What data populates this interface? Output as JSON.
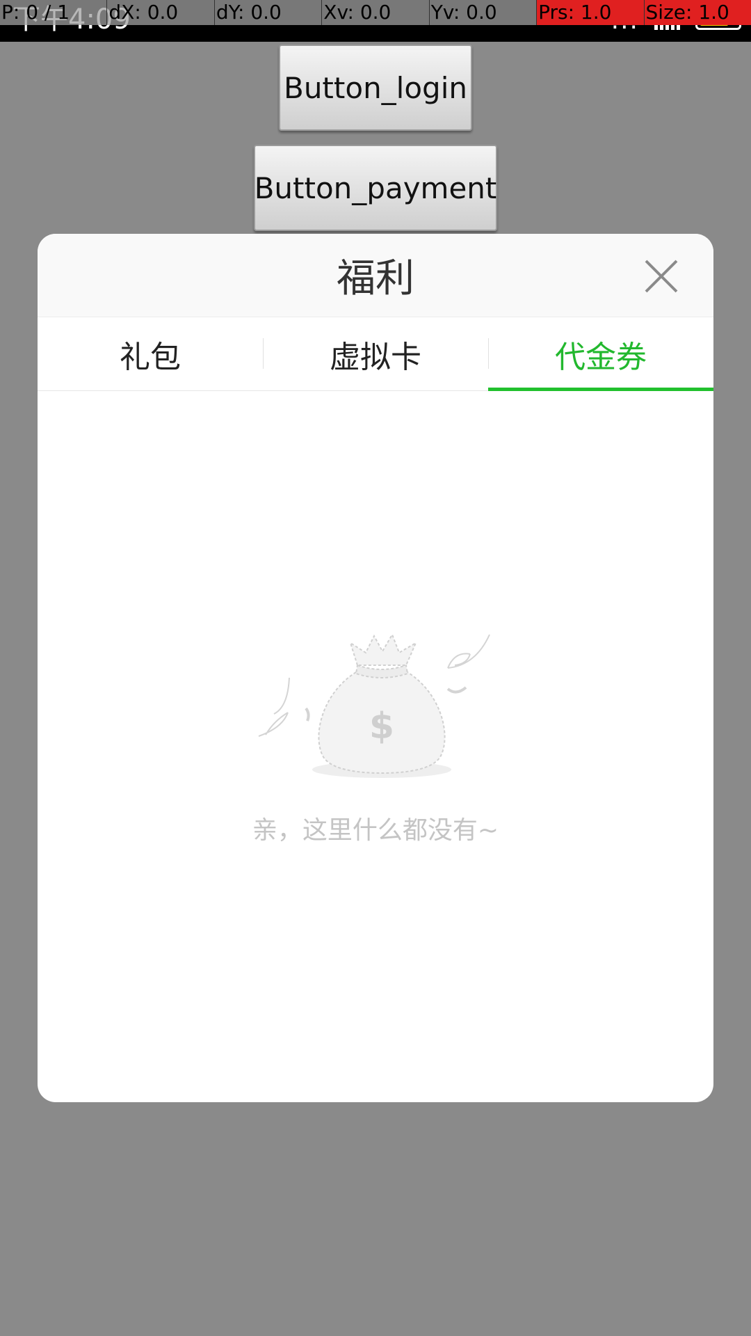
{
  "status_bar": {
    "time": "下午4:09",
    "dots": "..."
  },
  "debug_overlay": {
    "cells": [
      "P: 0 / 1",
      "dX: 0.0",
      "dY: 0.0",
      "Xv: 0.0",
      "Yv: 0.0",
      "Prs: 1.0",
      "Size: 1.0"
    ]
  },
  "buttons": {
    "login_label": "Button_login",
    "payment_label": "Button_payment"
  },
  "dialog": {
    "title": "福利",
    "tabs": [
      {
        "label": "礼包",
        "active": false
      },
      {
        "label": "虚拟卡",
        "active": false
      },
      {
        "label": "代金券",
        "active": true
      }
    ],
    "empty_message": "亲，这里什么都没有~",
    "illustration_icon": "money-bag-icon"
  },
  "colors": {
    "accent": "#22b82e",
    "backdrop": "#8a8a8a",
    "debug_alert": "#e02020"
  }
}
